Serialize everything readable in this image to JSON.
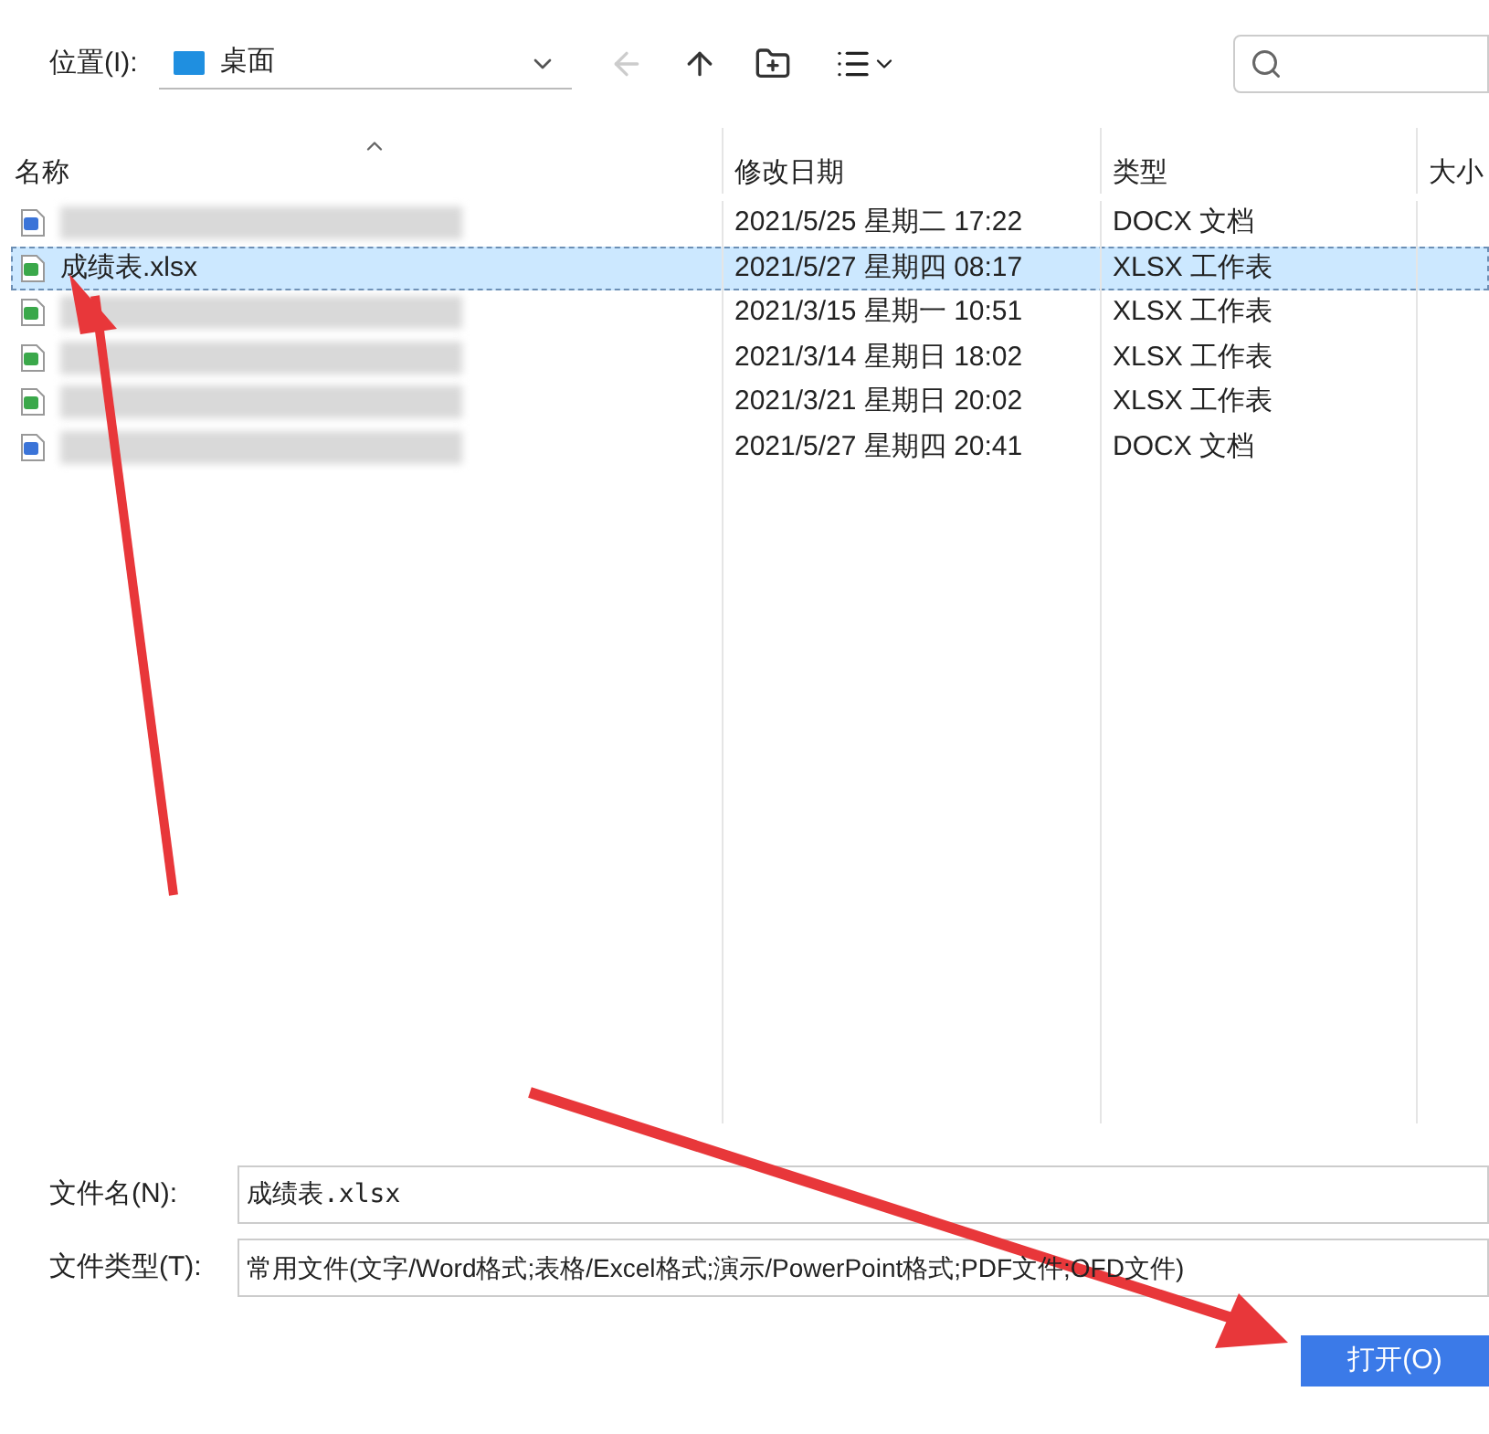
{
  "toolbar": {
    "location_label": "位置(I):",
    "location_value": "桌面"
  },
  "columns": [
    {
      "label": "名称",
      "sorted": true
    },
    {
      "label": "修改日期",
      "sorted": false
    },
    {
      "label": "类型",
      "sorted": false
    },
    {
      "label": "大小",
      "sorted": false
    }
  ],
  "rows": [
    {
      "kind": "docx",
      "selected": false,
      "date": "2021/5/25 星期二 17:22",
      "type": "DOCX 文档"
    },
    {
      "kind": "xlsx",
      "selected": true,
      "name": "成绩表.xlsx",
      "date": "2021/5/27 星期四 08:17",
      "type": "XLSX 工作表"
    },
    {
      "kind": "xlsx",
      "selected": false,
      "date": "2021/3/15 星期一 10:51",
      "type": "XLSX 工作表"
    },
    {
      "kind": "xlsx",
      "selected": false,
      "date": "2021/3/14 星期日 18:02",
      "type": "XLSX 工作表"
    },
    {
      "kind": "xlsx",
      "selected": false,
      "date": "2021/3/21 星期日 20:02",
      "type": "XLSX 工作表"
    },
    {
      "kind": "docx",
      "selected": false,
      "date": "2021/5/27 星期四 20:41",
      "type": "DOCX 文档"
    }
  ],
  "file_name": {
    "label": "文件名(N):",
    "value": "成绩表.xlsx"
  },
  "file_type": {
    "label": "文件类型(T):",
    "value": "常用文件(文字/Word格式;表格/Excel格式;演示/PowerPoint格式;PDF文件;OFD文件)"
  },
  "open_button": "打开(O)"
}
